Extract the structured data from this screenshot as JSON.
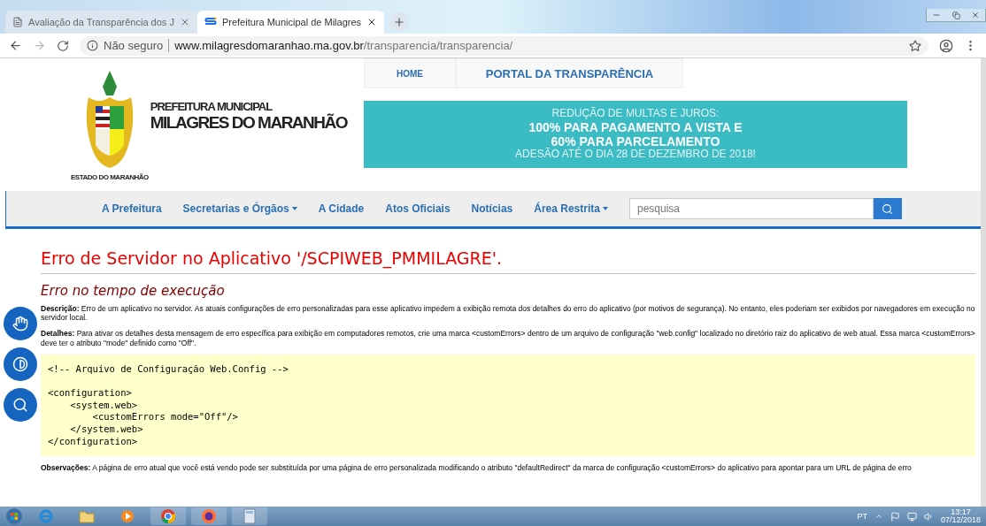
{
  "browser": {
    "tabs": [
      {
        "title": "Avaliação da Transparência dos J",
        "selected": false
      },
      {
        "title": "Prefeitura Municipal de Milagres",
        "selected": true
      }
    ],
    "security": "Não seguro",
    "url_host": "www.milagresdomaranhao.ma.gov.br",
    "url_path": "/transparencia/transparencia/"
  },
  "header": {
    "title_small": "PREFEITURA MUNICIPAL",
    "title_big": "MILAGRES DO MARANHÃO",
    "state": "ESTADO DO MARANHÃO",
    "top_links": [
      "HOME",
      "PORTAL DA TRANSPARÊNCIA"
    ],
    "banner": [
      "REDUÇÃO DE MULTAS E JUROS:",
      "100% PARA PAGAMENTO A VISTA E",
      "60% PARA PARCELAMENTO",
      "ADESÃO ATÉ O DIA 28 DE DEZEMBRO DE 2018!"
    ]
  },
  "nav": {
    "items": [
      {
        "label": "A Prefeitura",
        "dropdown": false
      },
      {
        "label": "Secretarias e Órgãos",
        "dropdown": true
      },
      {
        "label": "A Cidade",
        "dropdown": false
      },
      {
        "label": "Atos Oficiais",
        "dropdown": false
      },
      {
        "label": "Notícias",
        "dropdown": false
      },
      {
        "label": "Área Restrita",
        "dropdown": true
      }
    ],
    "search_placeholder": "pesquisa"
  },
  "error": {
    "title": "Erro de Servidor no Aplicativo '/SCPIWEB_PMMILAGRE'.",
    "subtitle": "Erro no tempo de execução",
    "paragraphs": [
      "**Descrição:** Erro de um aplicativo no servidor. As atuais configurações de erro personalizadas para esse aplicativo impedem a exibição remota dos detalhes do erro do aplicativo (por motivos de segurança). No entanto, eles poderiam ser exibidos por navegadores em execução no servidor local.",
      "**Detalhes:** Para ativar os detalhes desta mensagem de erro específica para exibição em computadores remotos, crie uma marca <customErrors> dentro de um arquivo de configuração \"web.config\" localizado no diretório raiz do aplicativo de web atual. Essa marca <customErrors> deve ter o atributo \"mode\" definido como \"Off\"."
    ],
    "code": [
      "<!-- Arquivo de Configuração Web.Config -->",
      "<configuration>",
      "    <system.web>",
      "        <customErrors mode=\"Off\"/>",
      "    </system.web>",
      "</configuration>"
    ],
    "note": "**Observações:** A página de erro atual que você está vendo pode ser substituída por uma página de erro personalizada modificando o atributo \"defaultRedirect\" da marca de configuração <customErrors> do aplicativo para apontar para um URL de página de erro"
  },
  "taskbar": {
    "language": "PT",
    "time": "13:17",
    "date": "07/12/2018"
  }
}
